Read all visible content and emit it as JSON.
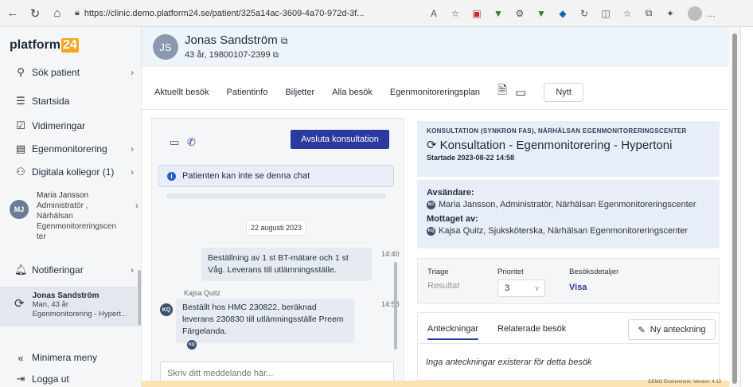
{
  "browser": {
    "url": "https://clinic.demo.platform24.se/patient/325a14ac-3609-4a70-972d-3f..."
  },
  "sidebar": {
    "logo_text": "platform",
    "logo_badge": "24",
    "items": [
      {
        "label": "Sök patient",
        "icon": "search-icon"
      },
      {
        "label": "Startsida",
        "icon": "list-icon"
      },
      {
        "label": "Vidimeringar",
        "icon": "checkbox-icon"
      },
      {
        "label": "Egenmonitorering",
        "icon": "monitor-icon"
      },
      {
        "label": "Digitala kollegor (1)",
        "icon": "users-icon"
      }
    ],
    "user": {
      "initials": "MJ",
      "name": "Maria Jansson",
      "role": "Administratör ,",
      "org1": "Närhälsan",
      "org2": "Egenmonitoreringscen",
      "org3": "ter"
    },
    "notifications": "Notifieringar",
    "active_patient": {
      "name": "Jonas Sandström",
      "info": "Man, 43 år",
      "plan": "Egenmonitorering - Hypert..."
    },
    "minimize": "Minimera meny",
    "logout": "Logga ut"
  },
  "patient": {
    "initials": "JS",
    "name": "Jonas Sandström",
    "info": "43 år, 19800107-2399"
  },
  "tabs": [
    "Aktuellt besök",
    "Patientinfo",
    "Biljetter",
    "Alla besök",
    "Egenmonitoreringsplan"
  ],
  "tab_new": "Nytt",
  "chat": {
    "end_button": "Avsluta konsultation",
    "notice": "Patienten kan inte se denna chat",
    "date": "22 augusti 2023",
    "msg_out": "Beställning av 1 st BT-mätare och 1 st Våg. Leverans till utlämningsställe.",
    "msg_out_time": "14:40",
    "msg_in_sender": "Kajsa Quitz",
    "msg_in_initials": "KQ",
    "msg_in": "Beställt hos HMC 230822, beräknad leverans 230830 till utlämningsställe Preem Färgelanda.",
    "msg_in_time": "14:58",
    "input_placeholder": "Skriv ditt meddelande här..."
  },
  "consultation": {
    "subtitle": "KONSULTATION (SYNKRON FAS), NÄRHÄLSAN EGENMONITORERINGSCENTER",
    "title": "Konsultation - Egenmonitorering - Hypertoni",
    "started": "Startade 2023-08-22 14:58",
    "sender_label": "Avsändare:",
    "sender_initials": "MJ",
    "sender": "Maria Jansson, Administratör, Närhälsan Egenmonitoreringscenter",
    "receiver_label": "Mottaget av:",
    "receiver_initials": "KQ",
    "receiver": "Kajsa Quitz, Sjuksköterska, Närhälsan Egenmonitoreringscenter",
    "triage_label": "Triage",
    "triage_value": "Resultat",
    "priority_label": "Prioritet",
    "priority_value": "3",
    "details_label": "Besöksdetaljer",
    "details_value": "Visa",
    "notes_tab": "Anteckningar",
    "related_tab": "Relaterade besök",
    "new_note": "Ny anteckning",
    "notes_empty": "Inga anteckningar existerar för detta besök"
  },
  "footer": {
    "env": "DEMO Environment. Version: 4.13"
  },
  "colors": {
    "primary": "#2b3a9e",
    "logo_badge": "#f5a623",
    "header_bg": "#edf5fa",
    "panel_bg": "#e8eef8",
    "demo_bar": "#fbe3b4"
  }
}
